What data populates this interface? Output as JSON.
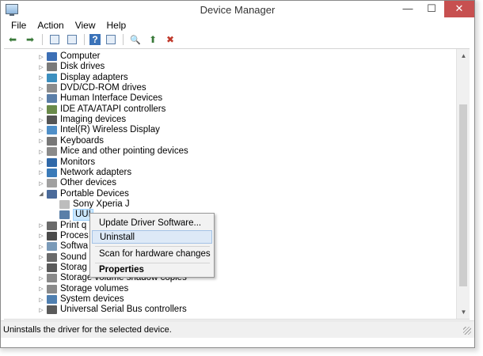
{
  "window": {
    "title": "Device Manager"
  },
  "menubar": [
    "File",
    "Action",
    "View",
    "Help"
  ],
  "toolbar": [
    {
      "name": "back-icon",
      "glyph": "⬅"
    },
    {
      "name": "forward-icon",
      "glyph": "➡"
    },
    {
      "name": "properties-icon",
      "glyph": ""
    },
    {
      "name": "show-hide-console-tree-icon",
      "glyph": ""
    },
    {
      "name": "help-icon",
      "glyph": "?"
    },
    {
      "name": "action-pane-icon",
      "glyph": ""
    },
    {
      "name": "scan-hardware-icon",
      "glyph": "🔍"
    },
    {
      "name": "update-driver-icon",
      "glyph": "⬆"
    },
    {
      "name": "uninstall-icon",
      "glyph": "✖"
    }
  ],
  "tree": [
    {
      "label": "Computer",
      "level": 1,
      "expander": "▷",
      "icon": "computer-icon",
      "color": "#3c6fb5"
    },
    {
      "label": "Disk drives",
      "level": 1,
      "expander": "▷",
      "icon": "disk-drive-icon",
      "color": "#7a7a7a"
    },
    {
      "label": "Display adapters",
      "level": 1,
      "expander": "▷",
      "icon": "display-adapter-icon",
      "color": "#3c8fbf"
    },
    {
      "label": "DVD/CD-ROM drives",
      "level": 1,
      "expander": "▷",
      "icon": "dvd-drive-icon",
      "color": "#8c8c8c"
    },
    {
      "label": "Human Interface Devices",
      "level": 1,
      "expander": "▷",
      "icon": "hid-icon",
      "color": "#5a7ea8"
    },
    {
      "label": "IDE ATA/ATAPI controllers",
      "level": 1,
      "expander": "▷",
      "icon": "ide-controller-icon",
      "color": "#6a8a4a"
    },
    {
      "label": "Imaging devices",
      "level": 1,
      "expander": "▷",
      "icon": "camera-icon",
      "color": "#555555"
    },
    {
      "label": "Intel(R) Wireless Display",
      "level": 1,
      "expander": "▷",
      "icon": "wireless-display-icon",
      "color": "#4f8fc8"
    },
    {
      "label": "Keyboards",
      "level": 1,
      "expander": "▷",
      "icon": "keyboard-icon",
      "color": "#777777"
    },
    {
      "label": "Mice and other pointing devices",
      "level": 1,
      "expander": "▷",
      "icon": "mouse-icon",
      "color": "#8a8a8a"
    },
    {
      "label": "Monitors",
      "level": 1,
      "expander": "▷",
      "icon": "monitor-icon",
      "color": "#2f68a8"
    },
    {
      "label": "Network adapters",
      "level": 1,
      "expander": "▷",
      "icon": "network-adapter-icon",
      "color": "#3a7ab8"
    },
    {
      "label": "Other devices",
      "level": 1,
      "expander": "▷",
      "icon": "other-devices-icon",
      "color": "#a0a0a0"
    },
    {
      "label": "Portable Devices",
      "level": 1,
      "expander": "◢",
      "icon": "portable-devices-icon",
      "color": "#4a6a9a"
    },
    {
      "label": "Sony Xperia J",
      "level": 2,
      "expander": "",
      "icon": "phone-icon",
      "color": "#bdbdbd"
    },
    {
      "label": "UUI",
      "level": 2,
      "expander": "",
      "icon": "portable-device-icon",
      "color": "#5a7fa8",
      "selected": true
    },
    {
      "label": "Print q",
      "level": 1,
      "expander": "▷",
      "icon": "printer-icon",
      "color": "#6a6a6a"
    },
    {
      "label": "Proces",
      "level": 1,
      "expander": "▷",
      "icon": "processor-icon",
      "color": "#4a4a4a"
    },
    {
      "label": "Softwa",
      "level": 1,
      "expander": "▷",
      "icon": "software-device-icon",
      "color": "#7a9ab8"
    },
    {
      "label": "Sound",
      "level": 1,
      "expander": "▷",
      "icon": "speaker-icon",
      "color": "#6a6a6a"
    },
    {
      "label": "Storag",
      "level": 1,
      "expander": "▷",
      "icon": "storage-controller-icon",
      "color": "#5a5a5a"
    },
    {
      "label": "Storage volume shadow copies",
      "level": 1,
      "expander": "▷",
      "icon": "shadow-copy-icon",
      "color": "#8a8a8a"
    },
    {
      "label": "Storage volumes",
      "level": 1,
      "expander": "▷",
      "icon": "storage-volume-icon",
      "color": "#8a8a8a"
    },
    {
      "label": "System devices",
      "level": 1,
      "expander": "▷",
      "icon": "system-devices-icon",
      "color": "#4f7fb0"
    },
    {
      "label": "Universal Serial Bus controllers",
      "level": 1,
      "expander": "▷",
      "icon": "usb-icon",
      "color": "#5a5a5a"
    }
  ],
  "context_menu": {
    "update": "Update Driver Software...",
    "uninstall": "Uninstall",
    "scan": "Scan for hardware changes",
    "properties": "Properties"
  },
  "status": {
    "text": "Uninstalls the driver for the selected device."
  }
}
